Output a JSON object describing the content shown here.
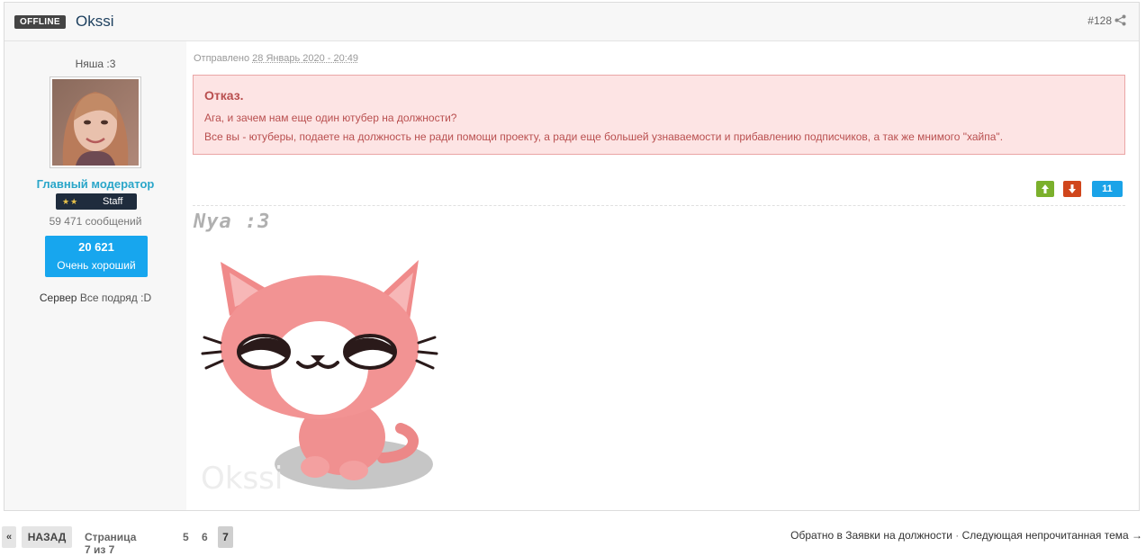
{
  "post": {
    "status_badge": "OFFLINE",
    "author": "Okssi",
    "number": "#128",
    "posted_prefix": "Отправлено",
    "posted_date": "28 Январь 2020 - 20:49",
    "share_icon": "share-icon"
  },
  "author_profile": {
    "title": "Няша :3",
    "group": "Главный модератор",
    "staff_label": "Staff",
    "staff_stars": "★★",
    "post_count": "59 471 сообщений",
    "reputation_value": "20 621",
    "reputation_label": "Очень хороший",
    "server_label": "Сервер",
    "server_value": "Все подряд :D"
  },
  "notice": {
    "title": "Отказ.",
    "line1": "Ага, и зачем нам еще один ютубер на должности?",
    "line2": "Все вы - ютуберы, подаете на должность не ради помощи проекту, а ради еще большей узнаваемости и прибавлению подписчиков, а так же мнимого \"хайпа\"."
  },
  "reactions": {
    "up_icon": "arrow-up-icon",
    "down_icon": "arrow-down-icon",
    "count": "11"
  },
  "signature": {
    "text": "Nya :3",
    "watermark": "Okssi"
  },
  "pagination": {
    "prev": "«",
    "back": "НАЗАД",
    "info": "Страница 7 из 7",
    "pages": [
      "5",
      "6",
      "7"
    ]
  },
  "footer_links": {
    "back_to": "Обратно в Заявки на должности",
    "separator": "·",
    "next_unread": "Следующая непрочитанная тема →"
  },
  "colors": {
    "notice_bg": "#fde4e4",
    "notice_text": "#b94f4f",
    "accent_blue": "#17a6ee",
    "group_color": "#2aa6c9"
  }
}
